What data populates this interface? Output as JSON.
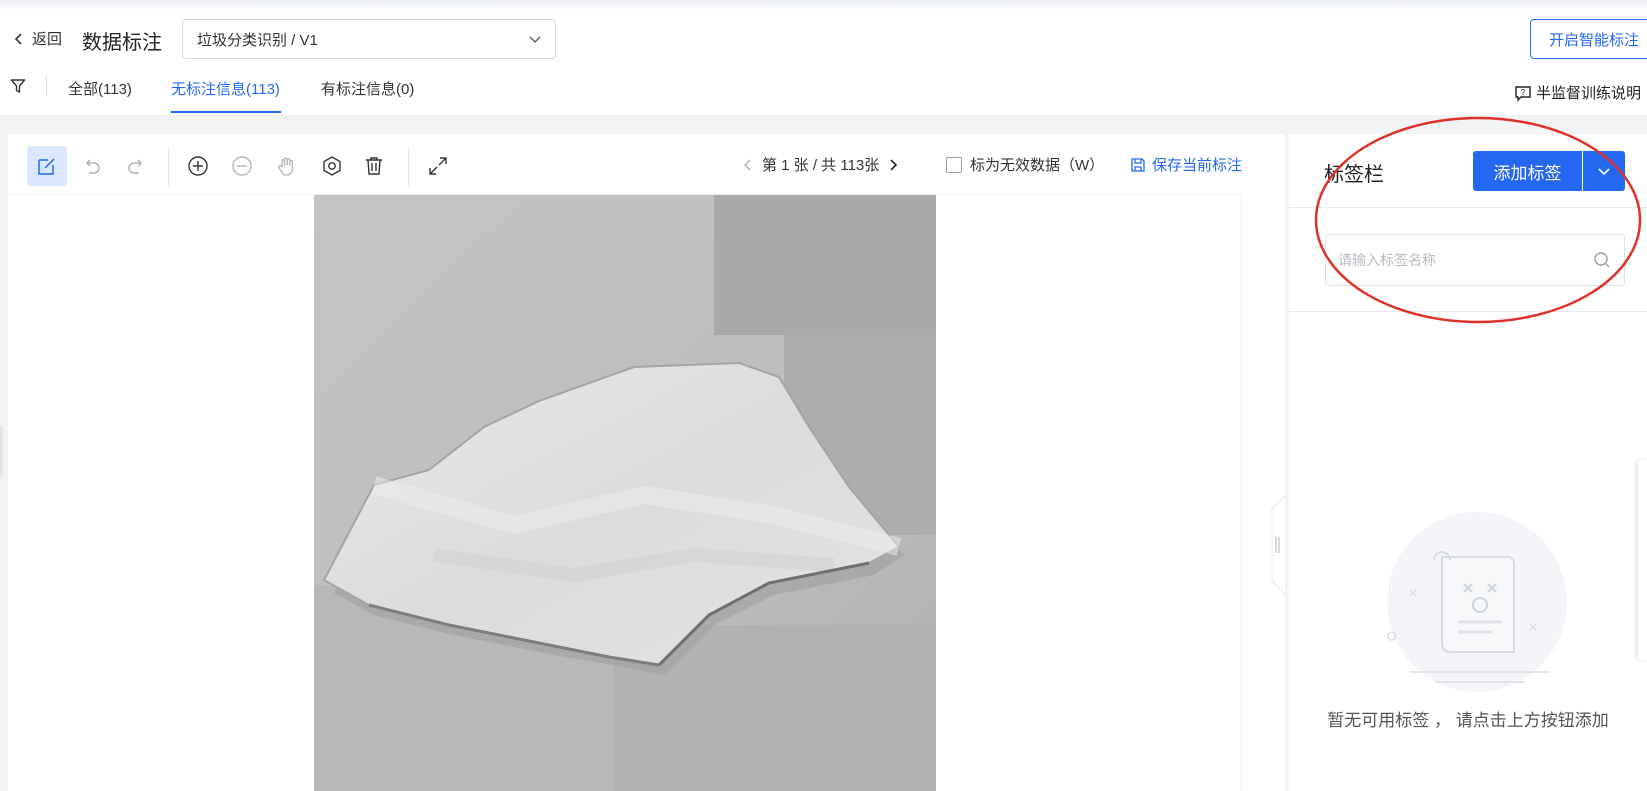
{
  "header": {
    "back_label": "返回",
    "title": "数据标注",
    "dataset_select": "垃圾分类识别 / V1",
    "smart_label_button": "开启智能标注",
    "help_link": "半监督训练说明"
  },
  "tabs": [
    {
      "label": "全部(113)",
      "active": false
    },
    {
      "label": "无标注信息(113)",
      "active": true
    },
    {
      "label": "有标注信息(0)",
      "active": false
    }
  ],
  "toolbar": {
    "tools": [
      "edit-rect-icon",
      "undo-icon",
      "redo-icon",
      "zoom-in-icon",
      "zoom-out-icon",
      "hand-pan-icon",
      "settings-icon",
      "delete-icon",
      "fullscreen-icon"
    ],
    "pager_text": "第 1 张 / 共 113张",
    "invalid_checkbox_label": "标为无效数据（W）",
    "invalid_checked": false,
    "save_label": "保存当前标注"
  },
  "label_panel": {
    "title": "标签栏",
    "add_button": "添加标签",
    "search_placeholder": "请输入标签名称",
    "empty_text": "暂无可用标签 ， 请点击上方按钮添加"
  },
  "colors": {
    "primary": "#2468f2",
    "annotation_circle": "#e0302a",
    "workarea_bg": "#f2f3f5"
  }
}
